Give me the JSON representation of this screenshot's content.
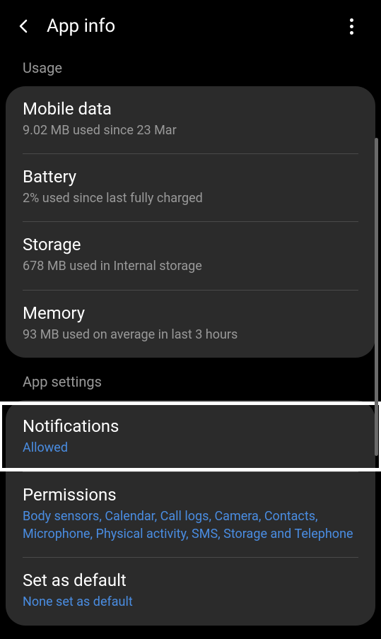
{
  "header": {
    "title": "App info"
  },
  "sections": {
    "usage": {
      "label": "Usage",
      "items": {
        "mobile_data": {
          "title": "Mobile data",
          "subtitle": "9.02 MB used since 23 Mar"
        },
        "battery": {
          "title": "Battery",
          "subtitle": "2% used since last fully charged"
        },
        "storage": {
          "title": "Storage",
          "subtitle": "678 MB used in Internal storage"
        },
        "memory": {
          "title": "Memory",
          "subtitle": "93 MB used on average in last 3 hours"
        }
      }
    },
    "app_settings": {
      "label": "App settings",
      "items": {
        "notifications": {
          "title": "Notifications",
          "subtitle": "Allowed"
        },
        "permissions": {
          "title": "Permissions",
          "subtitle": "Body sensors, Calendar, Call logs, Camera, Contacts, Microphone, Physical activity, SMS, Storage and Telephone"
        },
        "set_as_default": {
          "title": "Set as default",
          "subtitle": "None set as default"
        }
      }
    }
  }
}
